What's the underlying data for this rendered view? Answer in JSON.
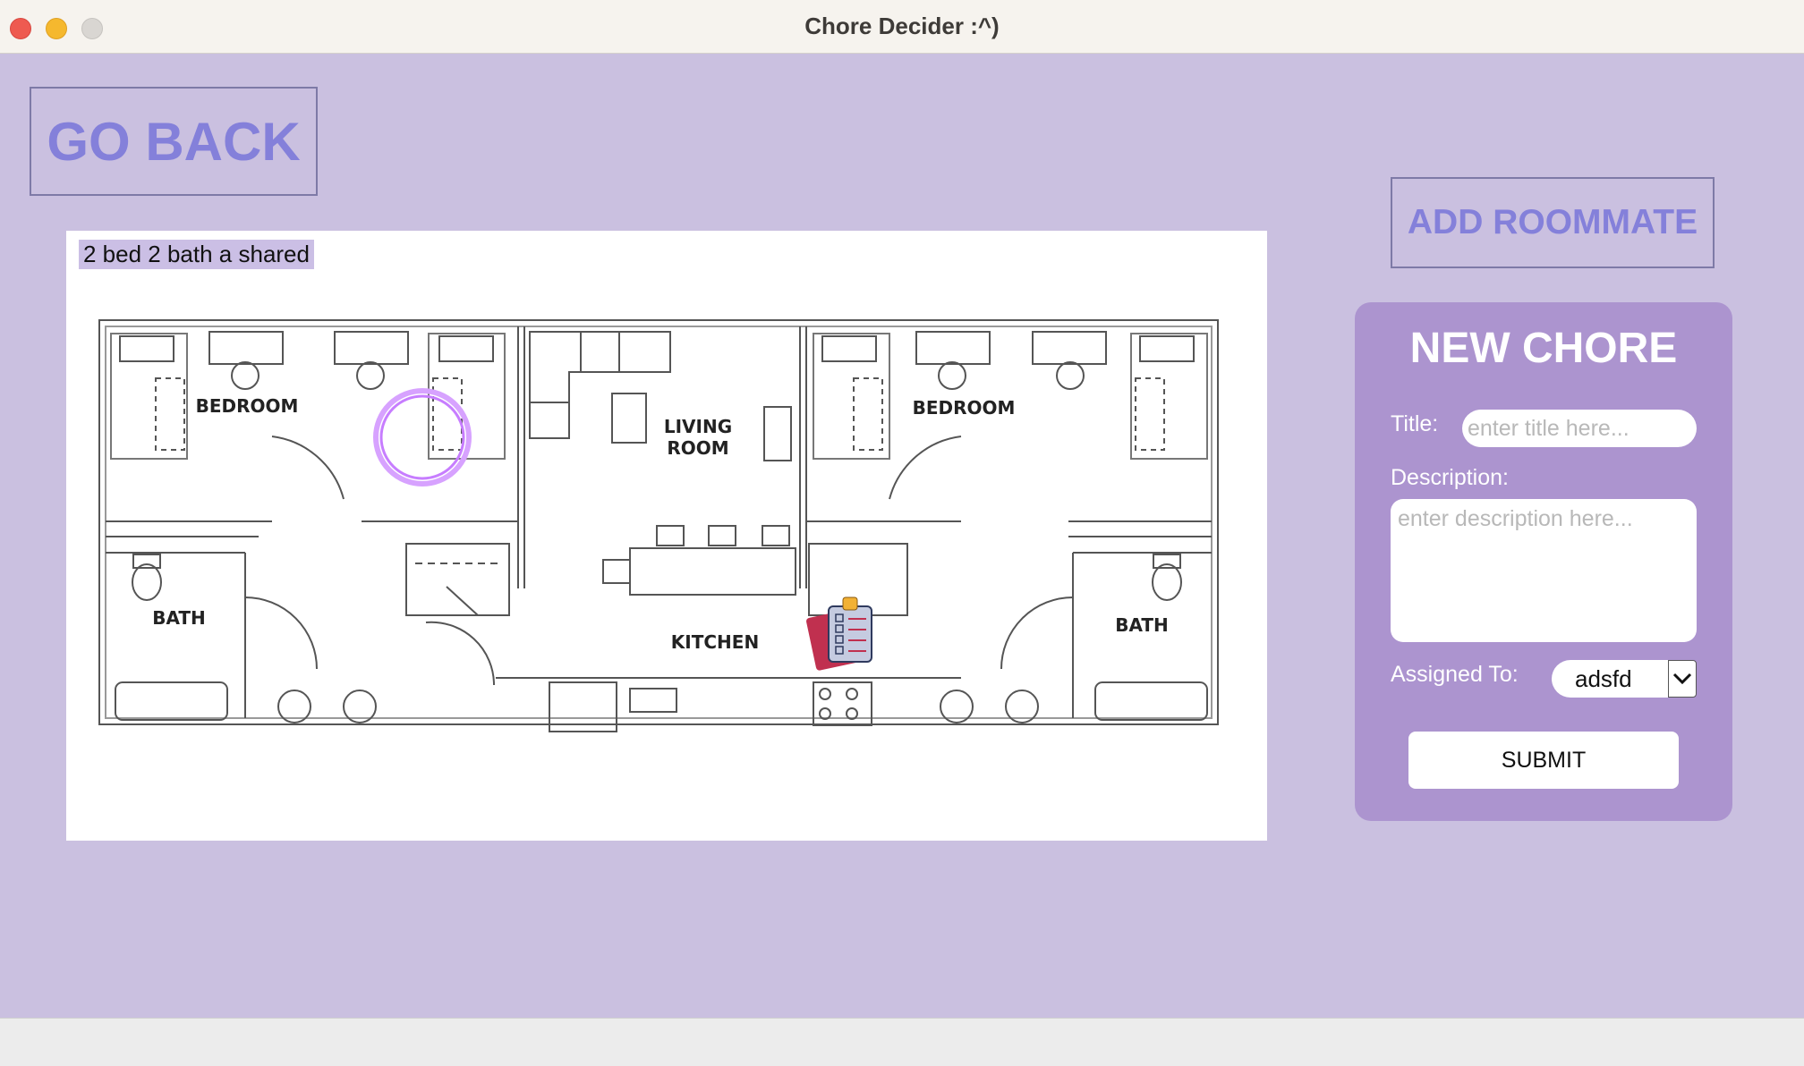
{
  "window": {
    "title": "Chore Decider :^)"
  },
  "buttons": {
    "go_back": "GO BACK",
    "add_roommate": "ADD ROOMMATE"
  },
  "floorplan": {
    "label": "2 bed 2 bath a shared",
    "rooms": {
      "bedroom_left": "BEDROOM",
      "bedroom_right": "BEDROOM",
      "living_line1": "LIVING",
      "living_line2": "ROOM",
      "bath_left": "BATH",
      "bath_right": "BATH",
      "kitchen": "KITCHEN"
    },
    "markers": [
      {
        "type": "ring",
        "color": "#c77dff"
      },
      {
        "type": "clipboard-icon",
        "color": "#c0304f"
      }
    ]
  },
  "form": {
    "heading": "NEW CHORE",
    "title_label": "Title:",
    "title_placeholder": "enter title here...",
    "description_label": "Description:",
    "description_placeholder": "enter description here...",
    "assigned_label": "Assigned To:",
    "assigned_value": "adsfd",
    "submit_label": "SUBMIT"
  },
  "colors": {
    "app_background": "#cac0e0",
    "button_text": "#8480da",
    "form_card": "#ac94cf"
  }
}
